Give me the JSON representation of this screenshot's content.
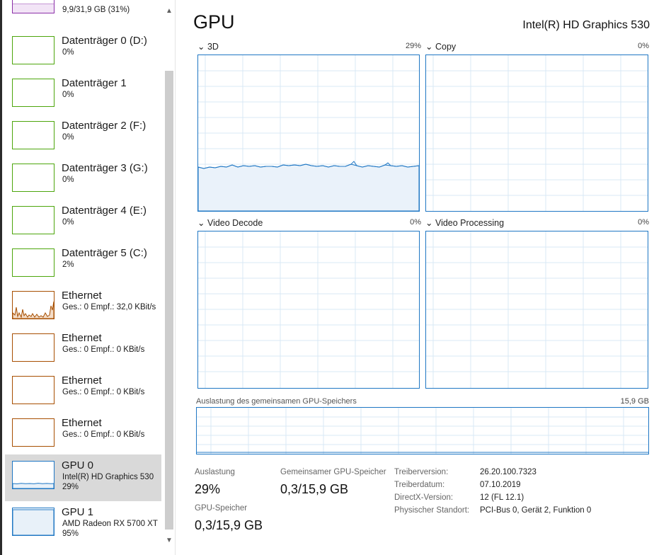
{
  "colors": {
    "memory": "#8b2fa8",
    "disk": "#4da60c",
    "ethernet": "#a74f01",
    "gpu": "#1f77c4"
  },
  "sidebar": {
    "items": [
      {
        "name": "",
        "sub1": "9,9/31,9 GB (31%)",
        "sub2": "",
        "kind": "memory"
      },
      {
        "name": "Datenträger 0 (D:)",
        "sub1": "0%",
        "sub2": "",
        "kind": "disk"
      },
      {
        "name": "Datenträger 1",
        "sub1": "0%",
        "sub2": "",
        "kind": "disk"
      },
      {
        "name": "Datenträger 2 (F:)",
        "sub1": "0%",
        "sub2": "",
        "kind": "disk"
      },
      {
        "name": "Datenträger 3 (G:)",
        "sub1": "0%",
        "sub2": "",
        "kind": "disk"
      },
      {
        "name": "Datenträger 4 (E:)",
        "sub1": "0%",
        "sub2": "",
        "kind": "disk"
      },
      {
        "name": "Datenträger 5 (C:)",
        "sub1": "2%",
        "sub2": "",
        "kind": "disk"
      },
      {
        "name": "Ethernet",
        "sub1": "Ges.: 0 Empf.: 32,0 KBit/s",
        "sub2": "",
        "kind": "ethernet"
      },
      {
        "name": "Ethernet",
        "sub1": "Ges.: 0 Empf.: 0 KBit/s",
        "sub2": "",
        "kind": "ethernet"
      },
      {
        "name": "Ethernet",
        "sub1": "Ges.: 0 Empf.: 0 KBit/s",
        "sub2": "",
        "kind": "ethernet"
      },
      {
        "name": "Ethernet",
        "sub1": "Ges.: 0 Empf.: 0 KBit/s",
        "sub2": "",
        "kind": "ethernet"
      },
      {
        "name": "GPU 0",
        "sub1": "Intel(R) HD Graphics 530",
        "sub2": "29%",
        "kind": "gpu",
        "selected": true
      },
      {
        "name": "GPU 1",
        "sub1": "AMD Radeon RX 5700 XT",
        "sub2": "95%",
        "kind": "gpu"
      }
    ],
    "scroll_up": "▲",
    "scroll_down": "▼"
  },
  "main": {
    "title": "GPU",
    "model": "Intel(R) HD Graphics 530",
    "engines": [
      {
        "label": "3D",
        "percent": "29%",
        "usage": 0.29
      },
      {
        "label": "Copy",
        "percent": "0%",
        "usage": 0
      },
      {
        "label": "Video Decode",
        "percent": "0%",
        "usage": 0
      },
      {
        "label": "Video Processing",
        "percent": "0%",
        "usage": 0
      }
    ],
    "chevron": "⌄",
    "shared_memory": {
      "label": "Auslastung des gemeinsamen GPU-Speichers",
      "max": "15,9 GB"
    },
    "stats": {
      "usage_label": "Auslastung",
      "usage_value": "29%",
      "shared_label": "Gemeinsamer GPU-Speicher",
      "shared_value": "0,3/15,9 GB",
      "gpu_mem_label": "GPU-Speicher",
      "gpu_mem_value": "0,3/15,9 GB"
    },
    "info": [
      {
        "key": "Treiberversion:",
        "value": "26.20.100.7323"
      },
      {
        "key": "Treiberdatum:",
        "value": "07.10.2019"
      },
      {
        "key": "DirectX-Version:",
        "value": "12 (FL 12.1)"
      },
      {
        "key": "Physischer Standort:",
        "value": "PCI-Bus 0, Gerät 2, Funktion 0"
      }
    ]
  }
}
